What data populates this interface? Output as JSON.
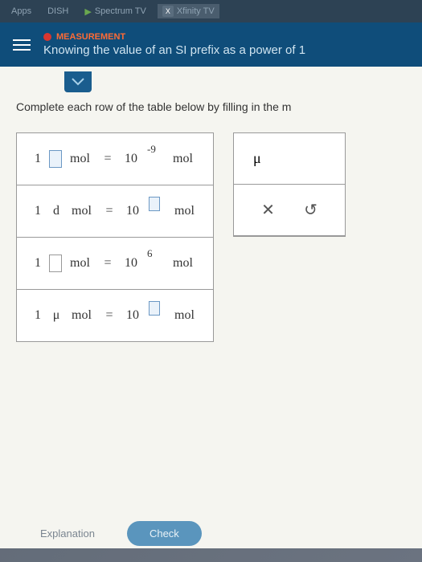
{
  "browser": {
    "bookmarks": [
      {
        "label": "Apps"
      },
      {
        "label": "DISH"
      },
      {
        "label": "Spectrum TV"
      },
      {
        "label": "Xfinity TV"
      }
    ]
  },
  "header": {
    "category": "MEASUREMENT",
    "title": "Knowing the value of an SI prefix as a power of 1"
  },
  "instruction": "Complete each row of the table below by filling in the m",
  "table": {
    "rows": [
      {
        "coeff": "1",
        "prefix": "",
        "prefixInput": true,
        "unit1": "mol",
        "eq": "=",
        "base": "10",
        "exp": "-9",
        "expInput": false,
        "unit2": "mol"
      },
      {
        "coeff": "1",
        "prefix": "d",
        "prefixInput": false,
        "unit1": "mol",
        "eq": "=",
        "base": "10",
        "exp": "",
        "expInput": true,
        "unit2": "mol"
      },
      {
        "coeff": "1",
        "prefix": "",
        "prefixInput": true,
        "unit1": "mol",
        "eq": "=",
        "base": "10",
        "exp": "6",
        "expInput": false,
        "unit2": "mol"
      },
      {
        "coeff": "1",
        "prefix": "μ",
        "prefixInput": false,
        "unit1": "mol",
        "eq": "=",
        "base": "10",
        "exp": "",
        "expInput": true,
        "unit2": "mol"
      }
    ]
  },
  "toolbox": {
    "mu": "μ",
    "clear": "✕",
    "reset": "↺"
  },
  "buttons": {
    "explanation": "Explanation",
    "check": "Check"
  }
}
